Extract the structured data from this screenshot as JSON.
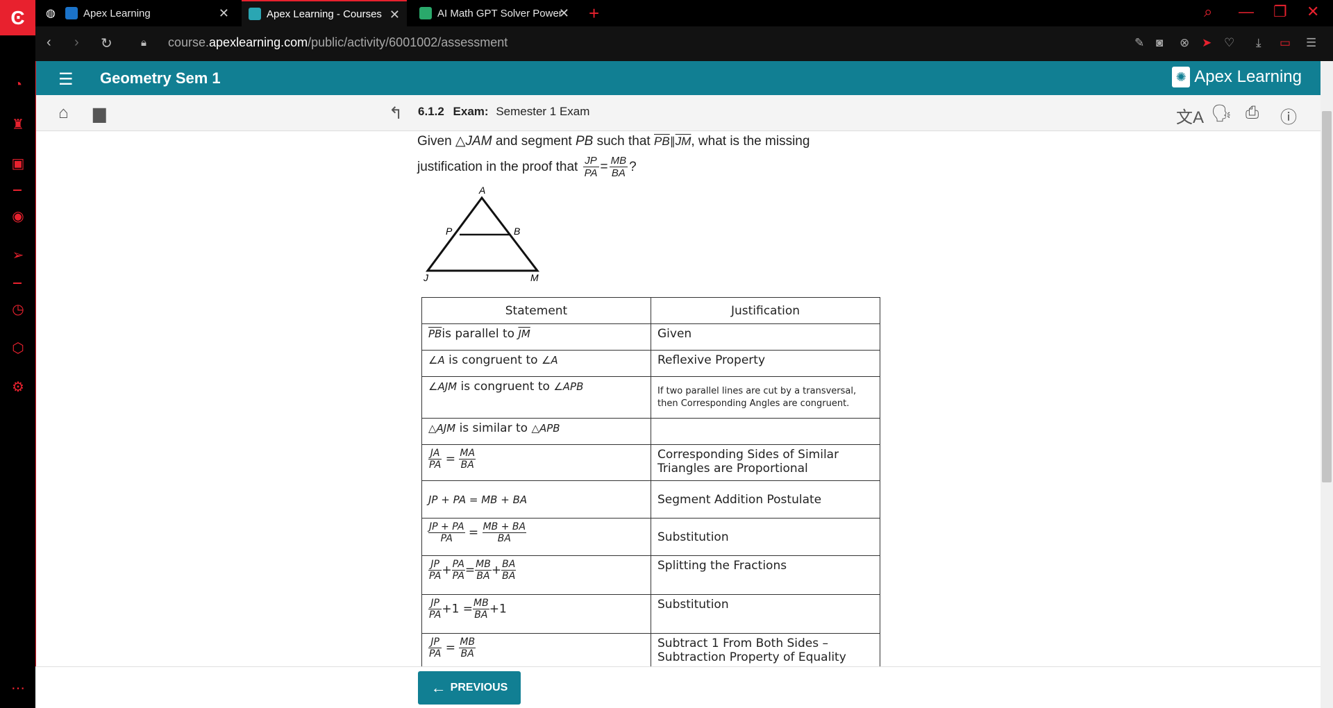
{
  "browser": {
    "tabs": [
      {
        "label": "Apex Learning",
        "favicon_color": "#1b73c9"
      },
      {
        "label": "Apex Learning - Courses",
        "favicon_color": "#2aa6b3"
      },
      {
        "label": "AI Math GPT Solver Powere",
        "favicon_color": "#2aa96b"
      }
    ],
    "url_prefix": "course.",
    "url_domain": "apexlearning.com",
    "url_path": "/public/activity/6001002/assessment"
  },
  "course": {
    "title": "Geometry Sem 1",
    "logo_text": "Apex Learning"
  },
  "activity": {
    "number": "6.1.2",
    "label": "Exam:",
    "name": "Semester 1 Exam"
  },
  "question": {
    "line1_a": "Given",
    "tri_name": "JAM",
    "line1_b": "and segment",
    "seg": "PB",
    "line1_c": "such that",
    "par_a": "PB",
    "par_b": "JM",
    "line1_d": ", what is the missing",
    "line2": "justification in the proof that",
    "f1_num": "JP",
    "f1_den": "PA",
    "f2_num": "MB",
    "f2_den": "BA",
    "end": "?"
  },
  "figure": {
    "labels": {
      "A": "A",
      "P": "P",
      "B": "B",
      "J": "J",
      "M": "M"
    }
  },
  "proof": {
    "headers": {
      "statement": "Statement",
      "justification": "Justification"
    },
    "rows": [
      {
        "just": "Given"
      },
      {
        "just": "Reflexive Property"
      },
      {
        "just": "If two parallel lines are cut by a transversal, then Corresponding Angles are congruent."
      },
      {
        "just": ""
      },
      {
        "just": "Corresponding Sides of Similar Triangles are Proportional"
      },
      {
        "just": "Segment Addition Postulate"
      },
      {
        "just": "Substitution"
      },
      {
        "just": "Splitting the Fractions"
      },
      {
        "just": "Substitution"
      },
      {
        "just": "Subtract 1 From Both Sides – Subtraction Property of Equality"
      }
    ],
    "s1": {
      "a": "PB",
      "b": "is parallel to",
      "c": "JM"
    },
    "s2": {
      "a": "∠A",
      "b": "is congruent to",
      "c": "∠A"
    },
    "s3": {
      "a": "∠AJM",
      "b": "is congruent to",
      "c": "∠APB"
    },
    "s4": {
      "a": "△AJM",
      "b": "is similar to",
      "c": "△APB"
    },
    "s5": {
      "n1": "JA",
      "d1": "PA",
      "n2": "MA",
      "d2": "BA"
    },
    "s6": {
      "text": "JP + PA = MB + BA"
    },
    "s7": {
      "n1": "JP + PA",
      "d1": "PA",
      "n2": "MB + BA",
      "d2": "BA"
    },
    "s8": {
      "n1": "JP",
      "d1": "PA",
      "n2": "PA",
      "d2": "PA",
      "n3": "MB",
      "d3": "BA",
      "n4": "BA",
      "d4": "BA"
    },
    "s9": {
      "n1": "JP",
      "d1": "PA",
      "mid": "+1 =",
      "n2": "MB",
      "d2": "BA",
      "end": "+1"
    },
    "s10": {
      "n1": "JP",
      "d1": "PA",
      "n2": "MB",
      "d2": "BA"
    }
  },
  "footer": {
    "previous_label": "PREVIOUS"
  },
  "colors": {
    "accent": "#117f93",
    "opera_red": "#e8212e"
  }
}
